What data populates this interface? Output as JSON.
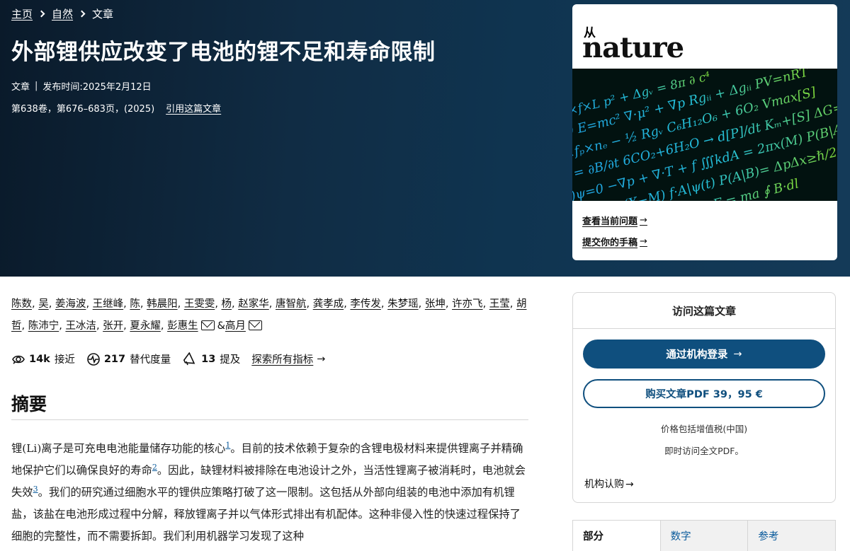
{
  "breadcrumb": {
    "home": "主页",
    "section": "自然",
    "current": "文章"
  },
  "article": {
    "title": "外部锂供应改变了电池的锂不足和寿命限制",
    "type": "文章",
    "published": "发布时间:2025年2月12日",
    "citation_meta": "第638卷，第676–683页，(2025)",
    "cite_link": "引用这篇文章"
  },
  "journal_card": {
    "from_label": "从",
    "journal_name": "nature",
    "current_issue": "查看当前问题",
    "submit": "提交你的手稿"
  },
  "authors": {
    "line1": [
      "陈数",
      "吴",
      "姜海波",
      "王继峰",
      "陈",
      "韩晨阳",
      "王雯雯",
      "杨",
      "赵家华",
      "唐智航",
      "龚孝成",
      "李传发",
      "朱梦瑶",
      "张坤",
      "许亦飞",
      "王莹",
      "胡"
    ],
    "line2a": [
      "哲",
      "陈沛宁",
      "王冰洁",
      "张开",
      "夏永耀",
      "彭惠生"
    ],
    "amp": "&",
    "last": "高月"
  },
  "metrics": {
    "accesses_num": "14k",
    "accesses_label": "接近",
    "altmetric_num": "217",
    "altmetric_label": "替代度量",
    "mentions_num": "13",
    "mentions_label": "提及",
    "explore": "探索所有指标"
  },
  "abstract": {
    "heading": "摘要",
    "p1": "锂(Li)离子是可充电电池能量储存功能的核心",
    "ref1": "1",
    "p2": "。目前的技术依赖于复杂的含锂电极材料来提供锂离子并精确地保护它们以确保良好的寿命",
    "ref2": "2",
    "p3": "。因此，缺锂材料被排除在电池设计之外，当活性锂离子被消耗时，电池就会失效",
    "ref3": "3",
    "p4": "。我们的研究通过细胞水平的锂供应策略打破了这一限制。这包括从外部向组装的电池中添加有机锂盐，该盐在电池形成过程中分解，释放锂离子并以气体形式排出有机配体。这种非侵入性的快速过程保持了细胞的完整性，而不需要拆卸。我们利用机器学习发现了这种"
  },
  "access": {
    "heading": "访问这篇文章",
    "login": "通过机构登录",
    "buy": "购买文章PDF 39，95 €",
    "vat_note": "价格包括增值税(中国)",
    "instant_note": "即时访问全文PDF。",
    "institutional": "机构认购"
  },
  "tabs": [
    "部分",
    "数字",
    "参考"
  ],
  "colors": {
    "primary": "#0f4f7e",
    "link": "#0b5b9c",
    "hero_bg": "#0f3450"
  }
}
